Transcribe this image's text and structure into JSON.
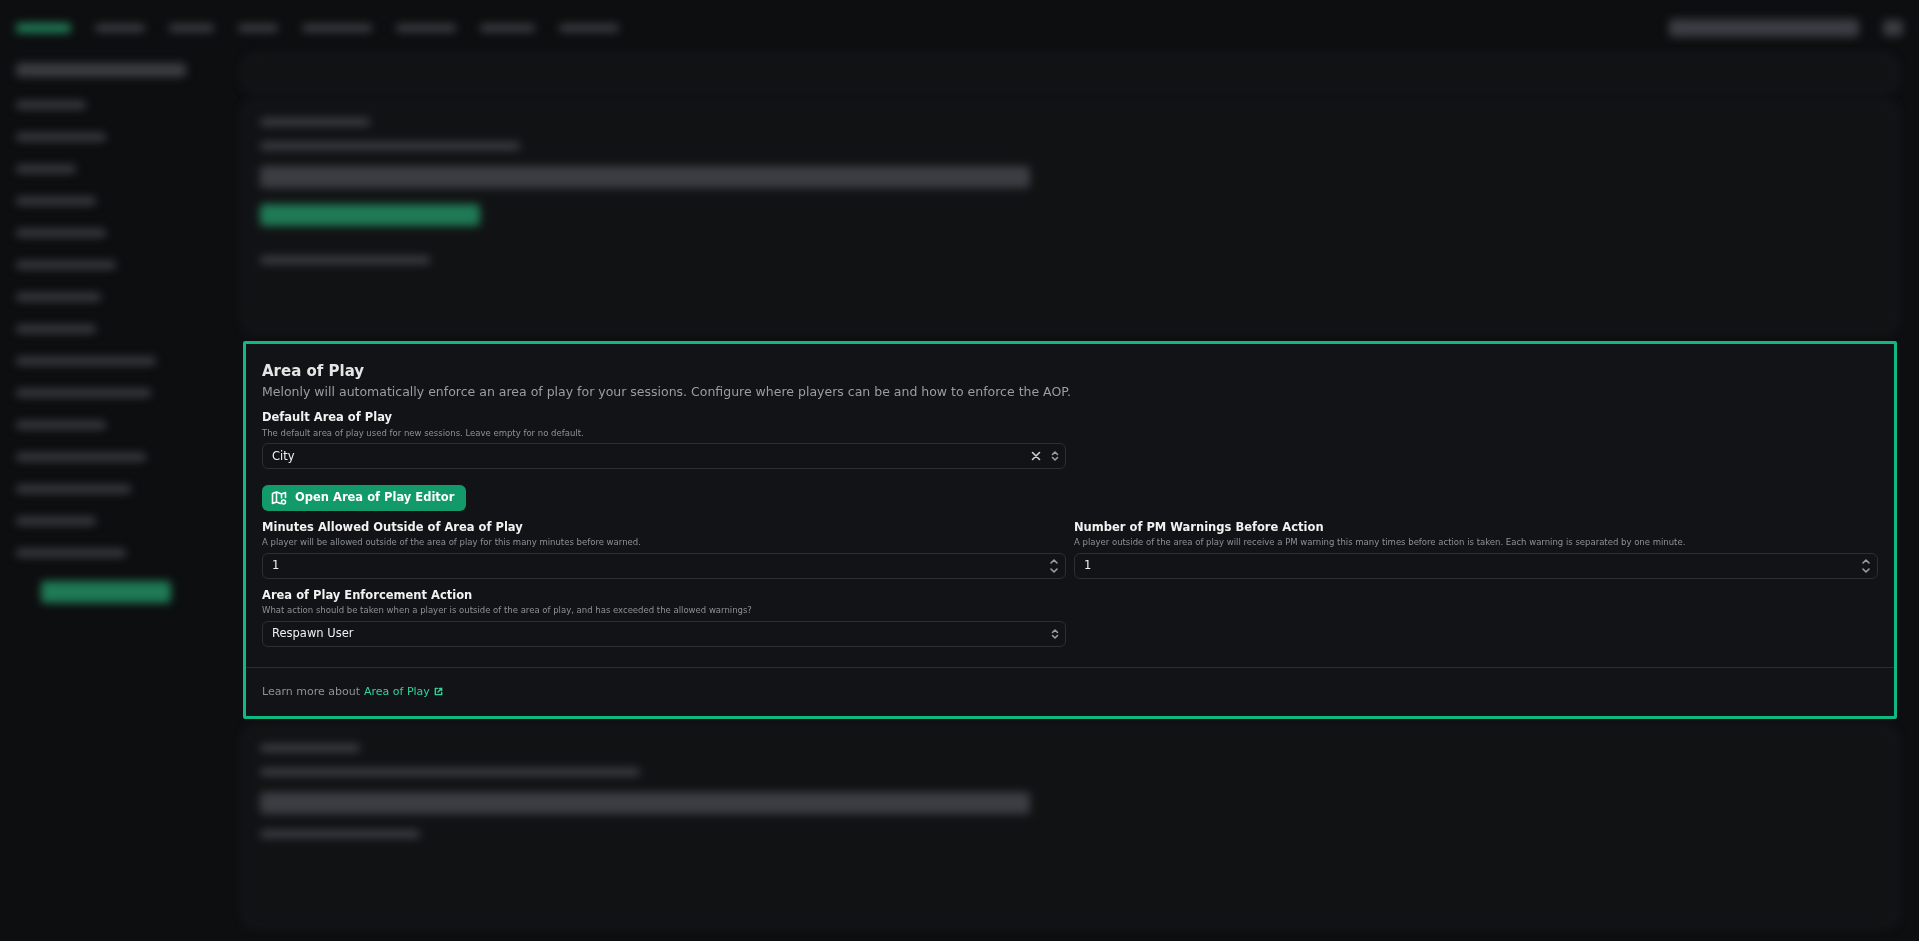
{
  "card": {
    "title": "Area of Play",
    "description": "Melonly will automatically enforce an area of play for your sessions. Configure where players can be and how to enforce the AOP.",
    "default_field": {
      "kind": "select",
      "label": "Default Area of Play",
      "hint": "The default area of play used for new sessions. Leave empty for no default.",
      "value": "City",
      "clearable": true
    },
    "editor_button": "Open Area of Play Editor",
    "fields": [
      {
        "kind": "number",
        "label": "Minutes Allowed Outside of Area of Play",
        "hint": "A player will be allowed outside of the area of play for this many minutes before warned.",
        "value": "1"
      },
      {
        "kind": "number",
        "label": "Number of PM Warnings Before Action",
        "hint": "A player outside of the area of play will receive a PM warning this many times before action is taken. Each warning is separated by one minute.",
        "value": "1"
      },
      {
        "kind": "select",
        "label": "Area of Play Enforcement Action",
        "hint": "What action should be taken when a player is outside of the area of play, and has exceeded the allowed warnings?",
        "value": "Respawn User",
        "clearable": false
      }
    ],
    "footer": {
      "text": "Learn more about",
      "link": "Area of Play"
    }
  }
}
